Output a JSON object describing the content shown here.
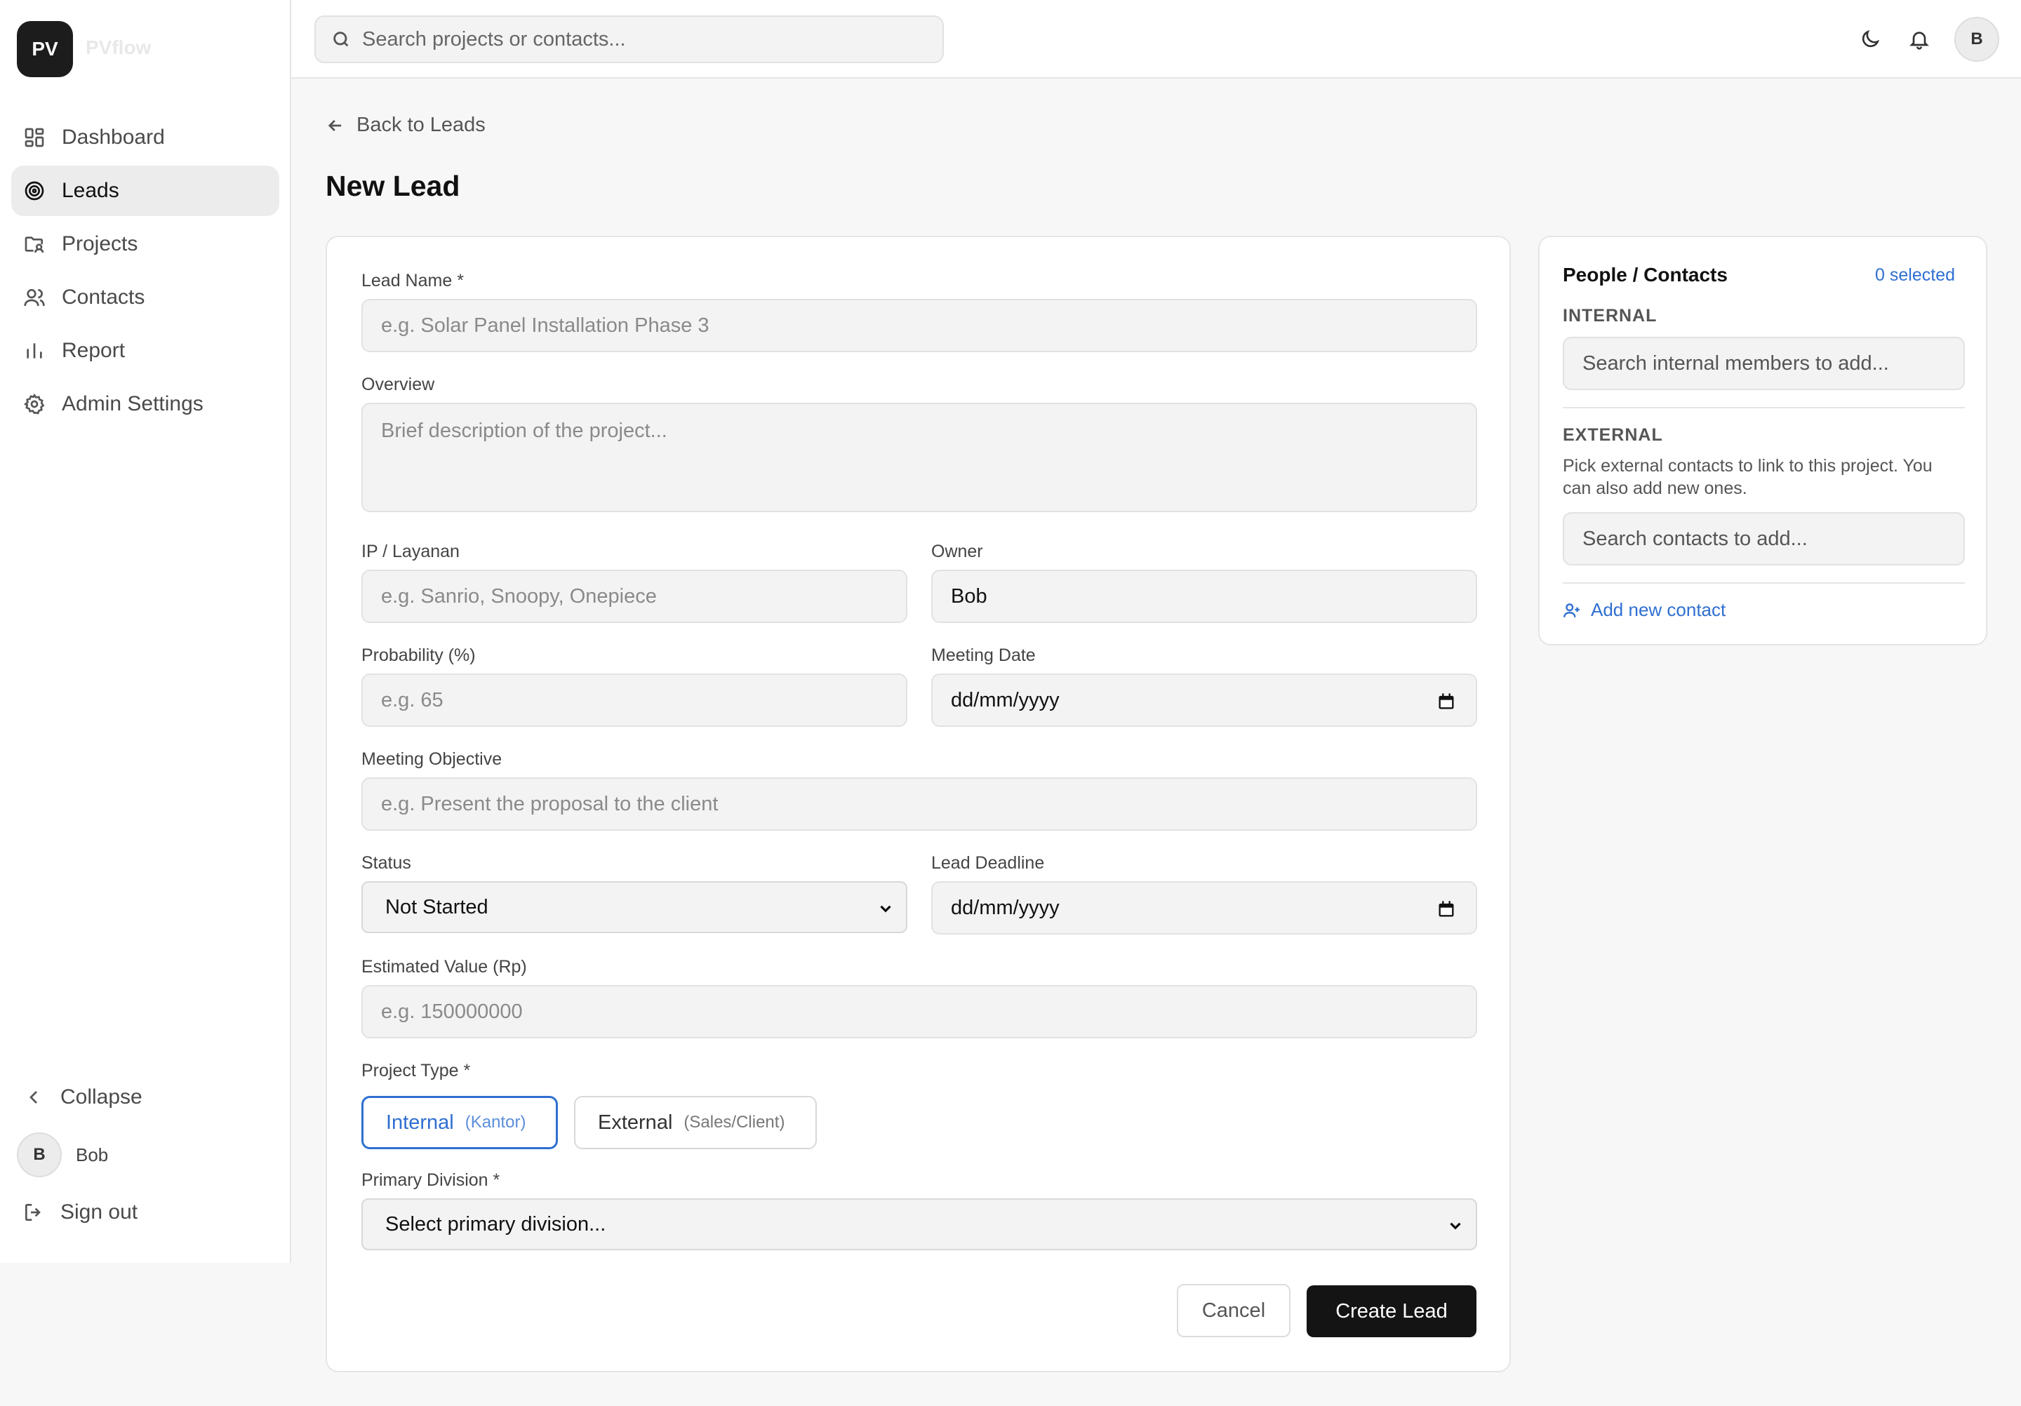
{
  "app": {
    "logo_initials": "PV",
    "logo_text": "PVflow"
  },
  "sidebar": {
    "items": [
      {
        "label": "Dashboard",
        "icon": "dashboard-icon",
        "active": false
      },
      {
        "label": "Leads",
        "icon": "target-icon",
        "active": true
      },
      {
        "label": "Projects",
        "icon": "folder-user-icon",
        "active": false
      },
      {
        "label": "Contacts",
        "icon": "users-icon",
        "active": false
      },
      {
        "label": "Report",
        "icon": "bar-chart-icon",
        "active": false
      },
      {
        "label": "Admin Settings",
        "icon": "gear-icon",
        "active": false
      }
    ],
    "collapse_label": "Collapse",
    "user": {
      "initial": "B",
      "name": "Bob"
    },
    "signout_label": "Sign out"
  },
  "header": {
    "search_placeholder": "Search projects or contacts...",
    "avatar_initial": "B"
  },
  "main": {
    "back_label": "Back to Leads",
    "page_title": "New Lead"
  },
  "form": {
    "lead_name": {
      "label": "Lead Name *",
      "placeholder": "e.g. Solar Panel Installation Phase 3"
    },
    "overview": {
      "label": "Overview",
      "placeholder": "Brief description of the project..."
    },
    "ip_layanan": {
      "label": "IP / Layanan",
      "placeholder": "e.g. Sanrio, Snoopy, Onepiece"
    },
    "owner": {
      "label": "Owner",
      "value": "Bob"
    },
    "probability": {
      "label": "Probability (%)",
      "placeholder": "e.g. 65"
    },
    "meeting_date": {
      "label": "Meeting Date",
      "value": "dd/mm/yyyy"
    },
    "meeting_objective": {
      "label": "Meeting Objective",
      "placeholder": "e.g. Present the proposal to the client"
    },
    "status": {
      "label": "Status",
      "value": "Not Started"
    },
    "lead_deadline": {
      "label": "Lead Deadline",
      "value": "dd/mm/yyyy"
    },
    "estimated_value": {
      "label": "Estimated Value (Rp)",
      "placeholder": "e.g. 150000000"
    },
    "project_type": {
      "label": "Project Type *",
      "options": [
        {
          "label": "Internal",
          "sub": "(Kantor)",
          "selected": true
        },
        {
          "label": "External",
          "sub": "(Sales/Client)",
          "selected": false
        }
      ]
    },
    "primary_division": {
      "label": "Primary Division *",
      "value": "Select primary division..."
    },
    "cancel_label": "Cancel",
    "create_label": "Create Lead"
  },
  "contacts": {
    "title": "People / Contacts",
    "selected_text": "0 selected",
    "internal_label": "INTERNAL",
    "internal_placeholder": "Search internal members to add...",
    "external_label": "EXTERNAL",
    "external_desc": "Pick external contacts to link to this project. You can also add new ones.",
    "external_placeholder": "Search contacts to add...",
    "add_new_label": "Add new contact"
  },
  "colors": {
    "accent": "#2f6fd0",
    "primary_button": "#141414",
    "background": "#f7f7f7"
  }
}
